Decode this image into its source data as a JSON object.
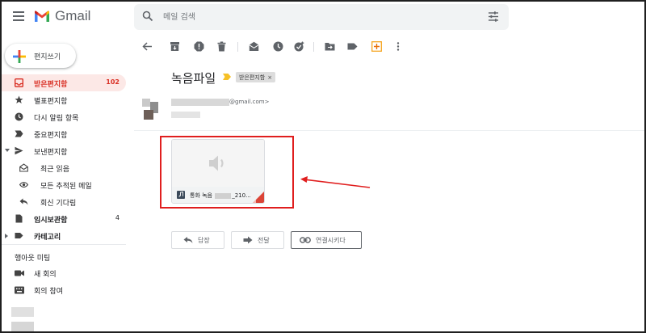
{
  "app": {
    "name": "Gmail"
  },
  "search": {
    "placeholder": "메일 검색"
  },
  "compose": {
    "label": "편지쓰기"
  },
  "sidebar": {
    "items": [
      {
        "label": "받은편지함",
        "count": "102",
        "icon": "inbox-icon"
      },
      {
        "label": "별표편지함",
        "count": "",
        "icon": "star-icon"
      },
      {
        "label": "다시 알림 항목",
        "count": "",
        "icon": "clock-icon"
      },
      {
        "label": "중요편지함",
        "count": "",
        "icon": "important-icon"
      },
      {
        "label": "보낸편지함",
        "count": "",
        "icon": "send-icon"
      },
      {
        "label": "최근 읽음",
        "count": "",
        "icon": "envelope-open-icon"
      },
      {
        "label": "모든 추적된 메일",
        "count": "",
        "icon": "eye-icon"
      },
      {
        "label": "회신 기다림",
        "count": "",
        "icon": "reply-icon"
      },
      {
        "label": "임시보관함",
        "count": "4",
        "icon": "draft-icon"
      },
      {
        "label": "카테고리",
        "count": "",
        "icon": "label-icon"
      }
    ]
  },
  "meet": {
    "title": "행아웃 미팅",
    "items": [
      {
        "label": "새 회의",
        "icon": "video-icon"
      },
      {
        "label": "회의 참여",
        "icon": "keyboard-icon"
      }
    ]
  },
  "email": {
    "subject": "녹음파일",
    "label_chip": "받은편지함",
    "label_chip_close": "×",
    "sender_email_suffix": "@gmail.com>",
    "attachment": {
      "name_prefix": "통화 녹음",
      "name_suffix": "_210..."
    }
  },
  "actions": {
    "reply": "답장",
    "forward": "전달",
    "link": "연결시키다"
  },
  "colors": {
    "accent": "#d93025",
    "highlight": "#e01e1e"
  }
}
